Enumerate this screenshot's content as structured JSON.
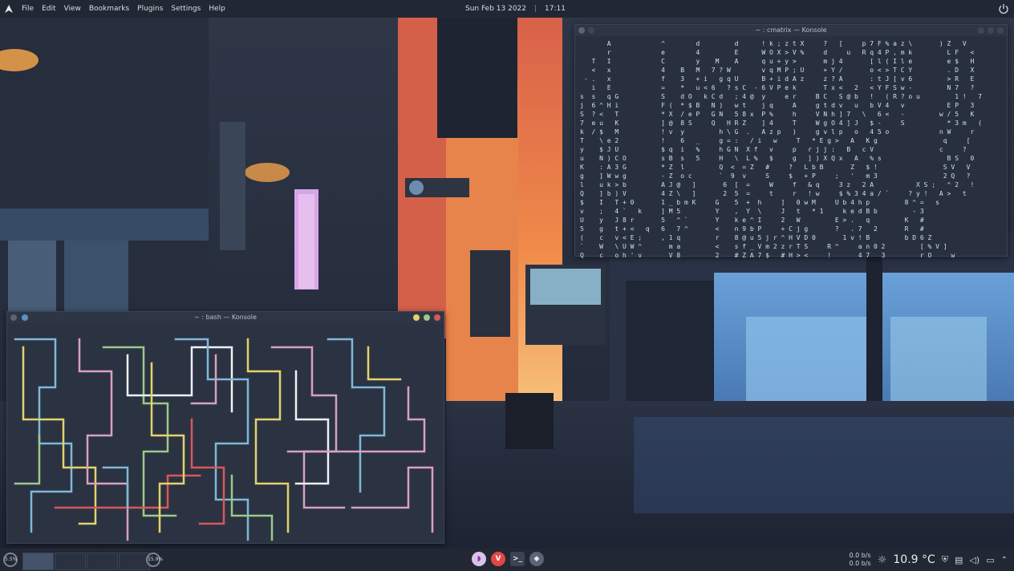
{
  "menubar": {
    "items": [
      "File",
      "Edit",
      "View",
      "Bookmarks",
      "Plugins",
      "Settings",
      "Help"
    ],
    "date": "Sun Feb 13 2022",
    "time": "17:11"
  },
  "cmatrix_window": {
    "title": "~ : cmatrix — Konsole",
    "text": "       A             ^        d         d      ! k ; z t X     ?   [     p 7 F % a z \\       ) Z   V\n       r             e        4         E      W O X > V %     d     u   R q 4 P , m k         L F   <\n   T   I             C        y    M    A      q u + y >       m j 4       [ l ( I l e         e $   H\n   <   x             4    B   M   7 ? W        v q M P ; U     + Y /       o < > T C Y         . D   X\n - .   x             f    3   + i   g q U      B + i d A z     z ? A       : t J [ v 6         > R   E\n   i   E             =    *   u < 6   ? s C  - 6 V P e k       T x <   2   < Y F S w -         N 7   ?\ns  s   q G           S    d O   k C d   ; 4 @  y     e r     B C   S @ b   !   ( R ? o u         1 !   7\nj  6 ^ H i           F (  * $ B   N )   w t    j q     A     g t d v   u   b V 4   v           E P   3\nS  ? <   T           * X  / e P   G N   5 8 x  P %     h     V N h ] 7   \\   6 <   -         w / 5   K\n7  e u   K           ] @  8 S     Q   H R Z    ] 4     T     W g O 4 ] J   $ -     S           * 3 m   (\nk  / $   M           ! v  y         h \\ G  .   A z p   )     g v l p   o   4 5 o             n W     r\nT    \\ e 2           !    6   _     g = :   / i   w     T   * E g >   A   K g                 q     [\ny    $ J U           $ q  i   %     h G N  X f   v     p   r j j :   B   c V                 c     ?\nu    N ) C O         s B  s   5     H   \\  L %   $     g   ] ) X Q x   A   % s                 B S   0\nK    : A 3 G         * Z  l         Q  <  = Z   #     ?   L b B       Z   $ !                 S V   V\ng    ] W w g         - Z  o c       `  9  v     S     $   + P     ;   '   m 3                 2 Q   ?\nl    u k > b         A J @   ]       6  [  =     W     f   & q     3 z   2 A           X S ;   ^ 2   !\nQ    ] b ) V         4 Z \\   ]       2  5  =     t     r   ! w     $ % 3 4 a / `     ? y !   A >   t\n$    I   T + 0       1 _ b m K     G    5  +  h     ]   0 w M     U b 4 h p         8 ^ =   s\nv    ;   4 `   k     ] M 5         Y    ,  Y  \\     J   t   * 1     k e d B b         - 3\nU    y   J 8 r       5   ^ `       Y    k e ^ I     2   W         E > .   q         K   #\n5    g   t + <   q   6   7 ^       <    n 9 b P     + C j g       ?   . 7   2       R   #\n(    c   v < E ;     , 1 q         r    8 @ u 5 j r ^ H V D 0       1 v ! B         b D 6 Z\n`    W   \\ U W ^       m a         <    s f _ V m 2 z r T S     R ^     a n 0 2         [ % V ]\nQ    c   o h ' v       V 8         2    # Z A 7 $   # H > <     !       4 7   3         r O     w"
  },
  "bash_window": {
    "title": "~ : bash — Konsole",
    "pipes_legend": "colored pipes screensaver"
  },
  "panel": {
    "cpu_left": "5.5%",
    "cpu_right": "15.9%",
    "net_down": "0.0 b/s",
    "net_up": "0.0 b/s",
    "temperature": "10.9 °C"
  },
  "colors": {
    "pipe_yellow": "#e3d36a",
    "pipe_blue": "#7fb8d8",
    "pipe_pink": "#d9a0c0",
    "pipe_green": "#9cc98a",
    "pipe_red": "#d8585a",
    "pipe_white": "#eef1f5"
  }
}
